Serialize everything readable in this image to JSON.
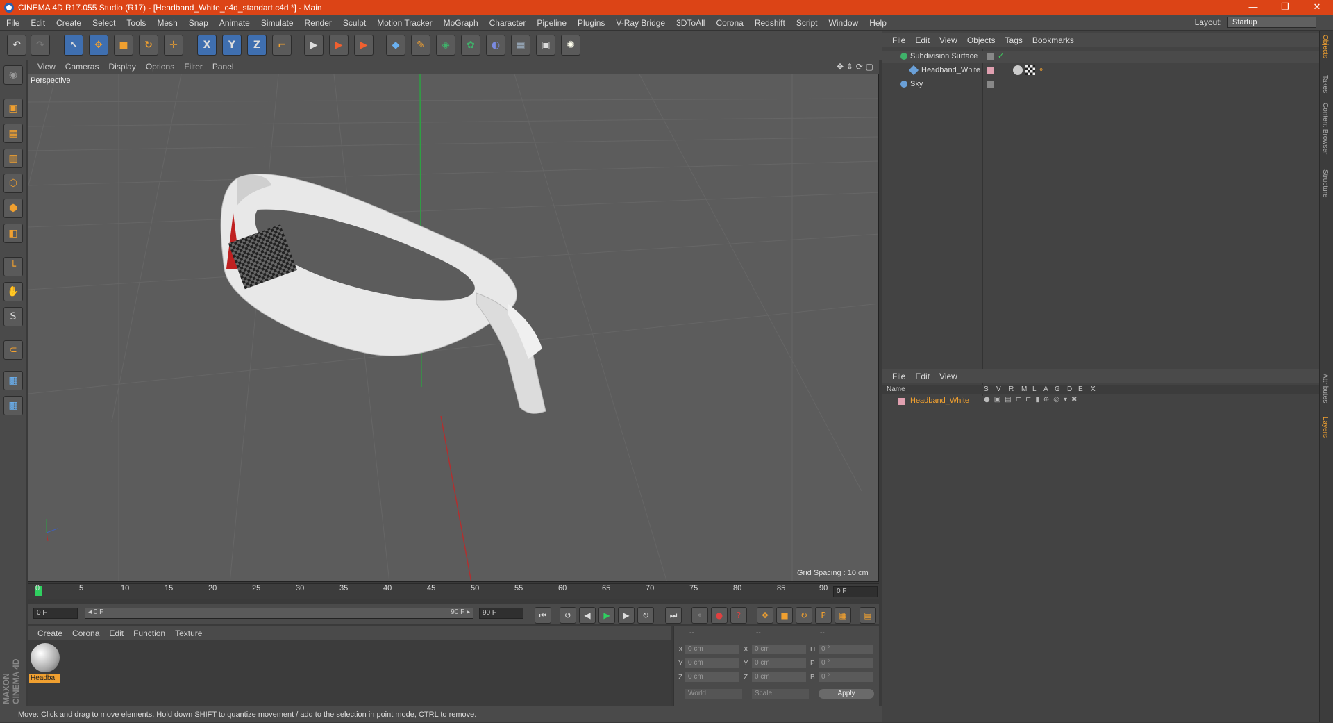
{
  "window": {
    "title": "CINEMA 4D R17.055 Studio (R17) - [Headband_White_c4d_standart.c4d *] - Main",
    "minimize": "—",
    "restore": "❐",
    "close": "✕"
  },
  "menu": [
    "File",
    "Edit",
    "Create",
    "Select",
    "Tools",
    "Mesh",
    "Snap",
    "Animate",
    "Simulate",
    "Render",
    "Sculpt",
    "Motion Tracker",
    "MoGraph",
    "Character",
    "Pipeline",
    "Plugins",
    "V-Ray Bridge",
    "3DToAll",
    "Corona",
    "Redshift",
    "Script",
    "Window",
    "Help"
  ],
  "layout": {
    "label": "Layout:",
    "value": "Startup"
  },
  "toolbar": {
    "undo": "↶",
    "redo": "↷",
    "select": "↖",
    "move": "✥",
    "scale": "■",
    "rotate": "↻",
    "add": "✛",
    "x": "X",
    "y": "Y",
    "z": "Z",
    "coord": "⌐",
    "render1": "▶",
    "render2": "▶",
    "render3": "▶",
    "cube": "◆",
    "pen": "✎",
    "subdiv": "◈",
    "cloner": "✿",
    "deform": "◐",
    "floor": "▦",
    "camera": "▣",
    "light": "✺"
  },
  "left_tools": [
    "◉",
    "▣",
    "▦",
    "▥",
    "⬡",
    "⬢",
    "◧",
    "└",
    "✋",
    "S",
    "⊂",
    "▩",
    "▩"
  ],
  "viewport": {
    "menus": [
      "View",
      "Cameras",
      "Display",
      "Options",
      "Filter",
      "Panel"
    ],
    "nav_icons": "✥ ⇕ ⟳ ▢",
    "label": "Perspective",
    "grid_spacing": "Grid Spacing : 10 cm"
  },
  "timeline": {
    "ticks": [
      "0",
      "5",
      "10",
      "15",
      "20",
      "25",
      "30",
      "35",
      "40",
      "45",
      "50",
      "55",
      "60",
      "65",
      "70",
      "75",
      "80",
      "85",
      "90"
    ],
    "current_frame": "0 F",
    "start_field": "0 F",
    "range_start": "◂ 0 F",
    "range_end": "90 F ▸",
    "end_field": "90 F"
  },
  "transport": [
    "⏮",
    "↺",
    "◀",
    "▶",
    "▶",
    "↻",
    "⏭",
    "⚬",
    "●",
    "?",
    "✥",
    "■",
    "↻",
    "P",
    "▦",
    "▤"
  ],
  "material_panel": {
    "menus": [
      "Create",
      "Corona",
      "Edit",
      "Function",
      "Texture"
    ],
    "material_name": "Headba"
  },
  "branding": "MAXON CINEMA 4D",
  "coordinates": {
    "headers": [
      "--",
      "--",
      "--"
    ],
    "rows": [
      {
        "axis1": "X",
        "v1": "0 cm",
        "axis2": "X",
        "v2": "0 cm",
        "axis3": "H",
        "v3": "0 °"
      },
      {
        "axis1": "Y",
        "v1": "0 cm",
        "axis2": "Y",
        "v2": "0 cm",
        "axis3": "P",
        "v3": "0 °"
      },
      {
        "axis1": "Z",
        "v1": "0 cm",
        "axis2": "Z",
        "v2": "0 cm",
        "axis3": "B",
        "v3": "0 °"
      }
    ],
    "space": "World",
    "mode": "Scale",
    "apply": "Apply"
  },
  "status": "Move: Click and drag to move elements. Hold down SHIFT to quantize movement / add to the selection in point mode, CTRL to remove.",
  "object_manager": {
    "menus": [
      "File",
      "Edit",
      "View",
      "Objects",
      "Tags",
      "Bookmarks"
    ],
    "objects": [
      {
        "name": "Subdivision Surface",
        "indent": 0,
        "color": "#3fb26a"
      },
      {
        "name": "Headband_White",
        "indent": 1,
        "color": "#6aa0d8"
      },
      {
        "name": "Sky",
        "indent": 0,
        "color": "#6aa0d8"
      }
    ]
  },
  "layer_manager": {
    "menus": [
      "File",
      "Edit",
      "View"
    ],
    "columns": [
      "Name",
      "S",
      "V",
      "R",
      "M",
      "L",
      "A",
      "G",
      "D",
      "E",
      "X"
    ],
    "layers": [
      {
        "name": "Headband_White",
        "color": "#f0a030"
      }
    ]
  },
  "side_tabs": [
    "Objects",
    "Takes",
    "Content Browser",
    "Structure",
    "Attributes",
    "Layers"
  ]
}
